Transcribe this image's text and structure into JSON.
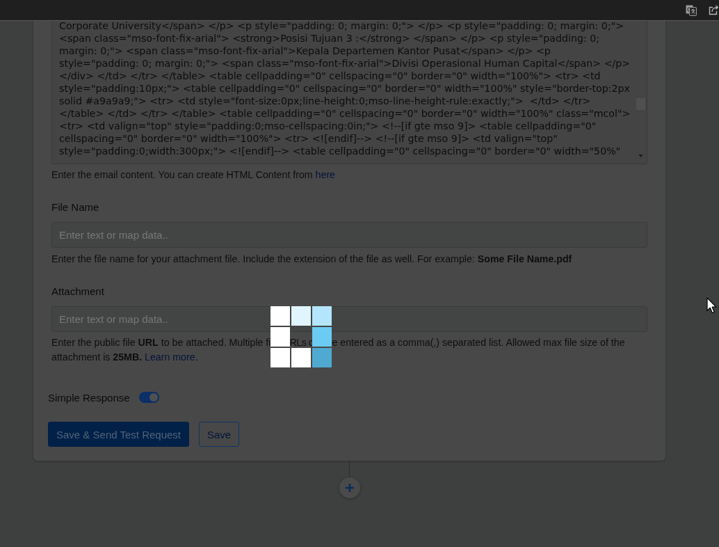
{
  "email_content": {
    "lines": [
      "Corporate University</span> </p> <p style=\"padding: 0; margin: 0;\"> </p> <p style=\"padding: 0; margin: 0;\">",
      "<span class=\"mso-font-fix-arial\"> <strong>Posisi Tujuan 3 :</strong> </span> </p> <p style=\"padding: 0;",
      "margin: 0;\"> <span class=\"mso-font-fix-arial\">Kepala Departemen Kantor Pusat</span> </p> <p",
      "style=\"padding: 0; margin: 0;\"> <span class=\"mso-font-fix-arial\">Divisi Operasional Human Capital</span> </p>",
      "</div> </td> </tr> </table> <table cellpadding=\"0\" cellspacing=\"0\" border=\"0\" width=\"100%\"> <tr> <td",
      "style=\"padding:10px;\"> <table cellpadding=\"0\" cellspacing=\"0\" border=\"0\" width=\"100%\" style=\"border-top:2px",
      "solid #a9a9a9;\"> <tr> <td style=\"font-size:0px;line-height:0;mso-line-height-rule:exactly;\">  </td> </tr>",
      "</table> </td> </tr> </table> <table cellpadding=\"0\" cellspacing=\"0\" border=\"0\" width=\"100%\" class=\"mcol\">",
      "<tr> <td valign=\"top\" style=\"padding:0;mso-cellspacing:0in;\"> <!--[if gte mso 9]> <table cellpadding=\"0\"",
      "cellspacing=\"0\" border=\"0\" width=\"100%\"> <tr> <![endif]--> <!--[if gte mso 9]> <td valign=\"top\"",
      "style=\"padding:0;width:300px;\"> <![endif]--> <table cellpadding=\"0\" cellspacing=\"0\" border=\"0\" width=\"50%\""
    ],
    "help": "Enter the email content. You can create HTML Content from",
    "help_link": "here"
  },
  "file_name": {
    "label": "File Name",
    "placeholder": "Enter text or map data..",
    "help": "Enter the file name for your attachment file. Include the extension of the file as well. For example: **Some File Name.pdf**"
  },
  "attachment": {
    "label": "Attachment",
    "placeholder": "Enter text or map data..",
    "help_segments": [
      "Enter the public file **URL** to be attached. Multiple fi",
      "RLs c",
      "e entered as a comma(,) separated list. Allowed max file size of the"
    ],
    "help_line_2": "attachment is **25MB.**",
    "help_link": "Learn more."
  },
  "simple_response": {
    "label": "Simple Response",
    "on": true
  },
  "buttons": [
    {
      "label": "Save & Send Test Request",
      "kind": "primary"
    },
    {
      "label": "Save",
      "kind": "secondary"
    }
  ]
}
